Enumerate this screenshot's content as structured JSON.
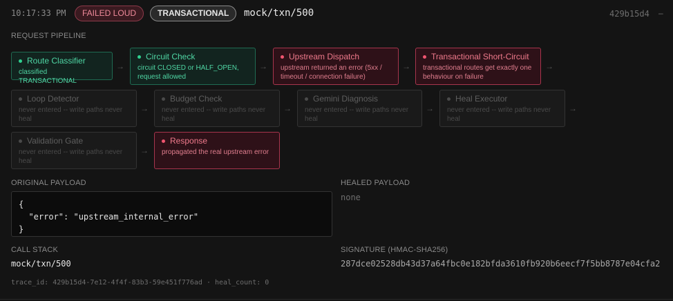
{
  "header": {
    "time": "10:17:33 PM",
    "status_badge": "FAILED LOUD",
    "mode_badge": "TRANSACTIONAL",
    "route": "mock/txn/500",
    "trace_short": "429b15d4",
    "trailing": "–"
  },
  "pipeline": {
    "label": "REQUEST PIPELINE",
    "arrow": "→",
    "nodes": [
      {
        "title": "Route Classifier",
        "desc": "classified TRANSACTIONAL",
        "state": "ok"
      },
      {
        "title": "Circuit Check",
        "desc": "circuit CLOSED or HALF_OPEN, request allowed",
        "state": "ok"
      },
      {
        "title": "Upstream Dispatch",
        "desc": "upstream returned an error (5xx / timeout / connection failure)",
        "state": "fail"
      },
      {
        "title": "Transactional Short-Circuit",
        "desc": "transactional routes get exactly one behaviour on failure",
        "state": "fail"
      },
      {
        "title": "Loop Detector",
        "desc": "never entered -- write paths never heal",
        "state": "skipped"
      },
      {
        "title": "Budget Check",
        "desc": "never entered -- write paths never heal",
        "state": "skipped"
      },
      {
        "title": "Gemini Diagnosis",
        "desc": "never entered -- write paths never heal",
        "state": "skipped"
      },
      {
        "title": "Heal Executor",
        "desc": "never entered -- write paths never heal",
        "state": "skipped"
      },
      {
        "title": "Validation Gate",
        "desc": "never entered -- write paths never heal",
        "state": "skipped"
      },
      {
        "title": "Response",
        "desc": "propagated the real upstream error",
        "state": "fail"
      }
    ]
  },
  "original_payload": {
    "label": "ORIGINAL PAYLOAD",
    "content": "{\n  \"error\": \"upstream_internal_error\"\n}"
  },
  "healed_payload": {
    "label": "HEALED PAYLOAD",
    "value": "none"
  },
  "call_stack": {
    "label": "CALL STACK",
    "value": "mock/txn/500"
  },
  "signature": {
    "label": "SIGNATURE (HMAC-SHA256)",
    "value": "287dce02528db43d37a64fbc0e182bfda3610fb920b6eecf7f5bb8787e04cfa2"
  },
  "footer": {
    "text": "trace_id: 429b15d4-7e12-4f4f-83b3-59e451f776ad · heal_count: 0"
  },
  "colors": {
    "ok": "#2fd08f",
    "fail": "#f05570",
    "skipped": "#4a4a4a",
    "background": "#141414"
  }
}
